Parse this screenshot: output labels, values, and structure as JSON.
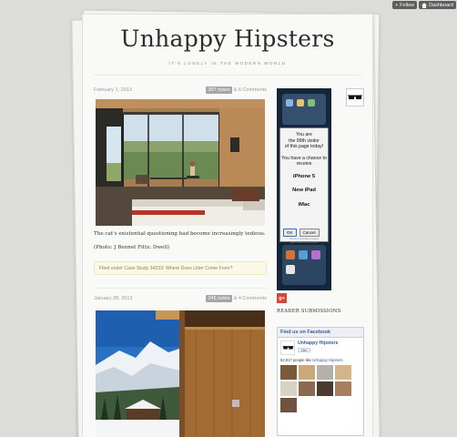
{
  "topbar": {
    "follow_label": "Follow",
    "dashboard_label": "Dashboard"
  },
  "blog": {
    "title": "Unhappy Hipsters",
    "tagline": "IT'S LONELY IN THE MODERN WORLD"
  },
  "posts": [
    {
      "date": "February 1, 2013",
      "notes": "397 notes",
      "comments": "& 6 Comments",
      "caption": "The cat's existential questioning had become increasingly tedious.",
      "credit": "(Photo: J Bennet Fitts; Dwell)",
      "filed": "Filed under Case Study 34233: Where Does Litter Come From?"
    },
    {
      "date": "January 28, 2013",
      "notes": "245 notes",
      "comments": "& 4 Comments"
    }
  ],
  "ad": {
    "lines": [
      "You are",
      "the 99th visitor",
      "of this page today!"
    ],
    "chance": [
      "You have a chance to",
      "receive"
    ],
    "prizes": [
      "iPhone 5",
      "New iPad",
      "iMac"
    ],
    "ok_label": "OK",
    "cancel_label": "Cancel",
    "fine_print": [
      "Terms & Conditions Apply",
      "Sponsored by PrizesWin"
    ]
  },
  "sidebar": {
    "gplus_label": "g+",
    "reader_submissions": "READER SUBMISSIONS"
  },
  "facebook": {
    "header": "Find us on Facebook",
    "page_name": "Unhappy Hipsters",
    "like_label": "Like",
    "count_text": "52,917 people like",
    "count_link": "Unhappy Hipsters."
  },
  "colors": {
    "background": "#dcdcd8",
    "facebook_blue": "#3b5998",
    "gplus_red": "#d34836",
    "notes_badge": "#a6a6a6"
  },
  "icons": [
    "plus-icon",
    "home-icon",
    "glasses-icon"
  ]
}
